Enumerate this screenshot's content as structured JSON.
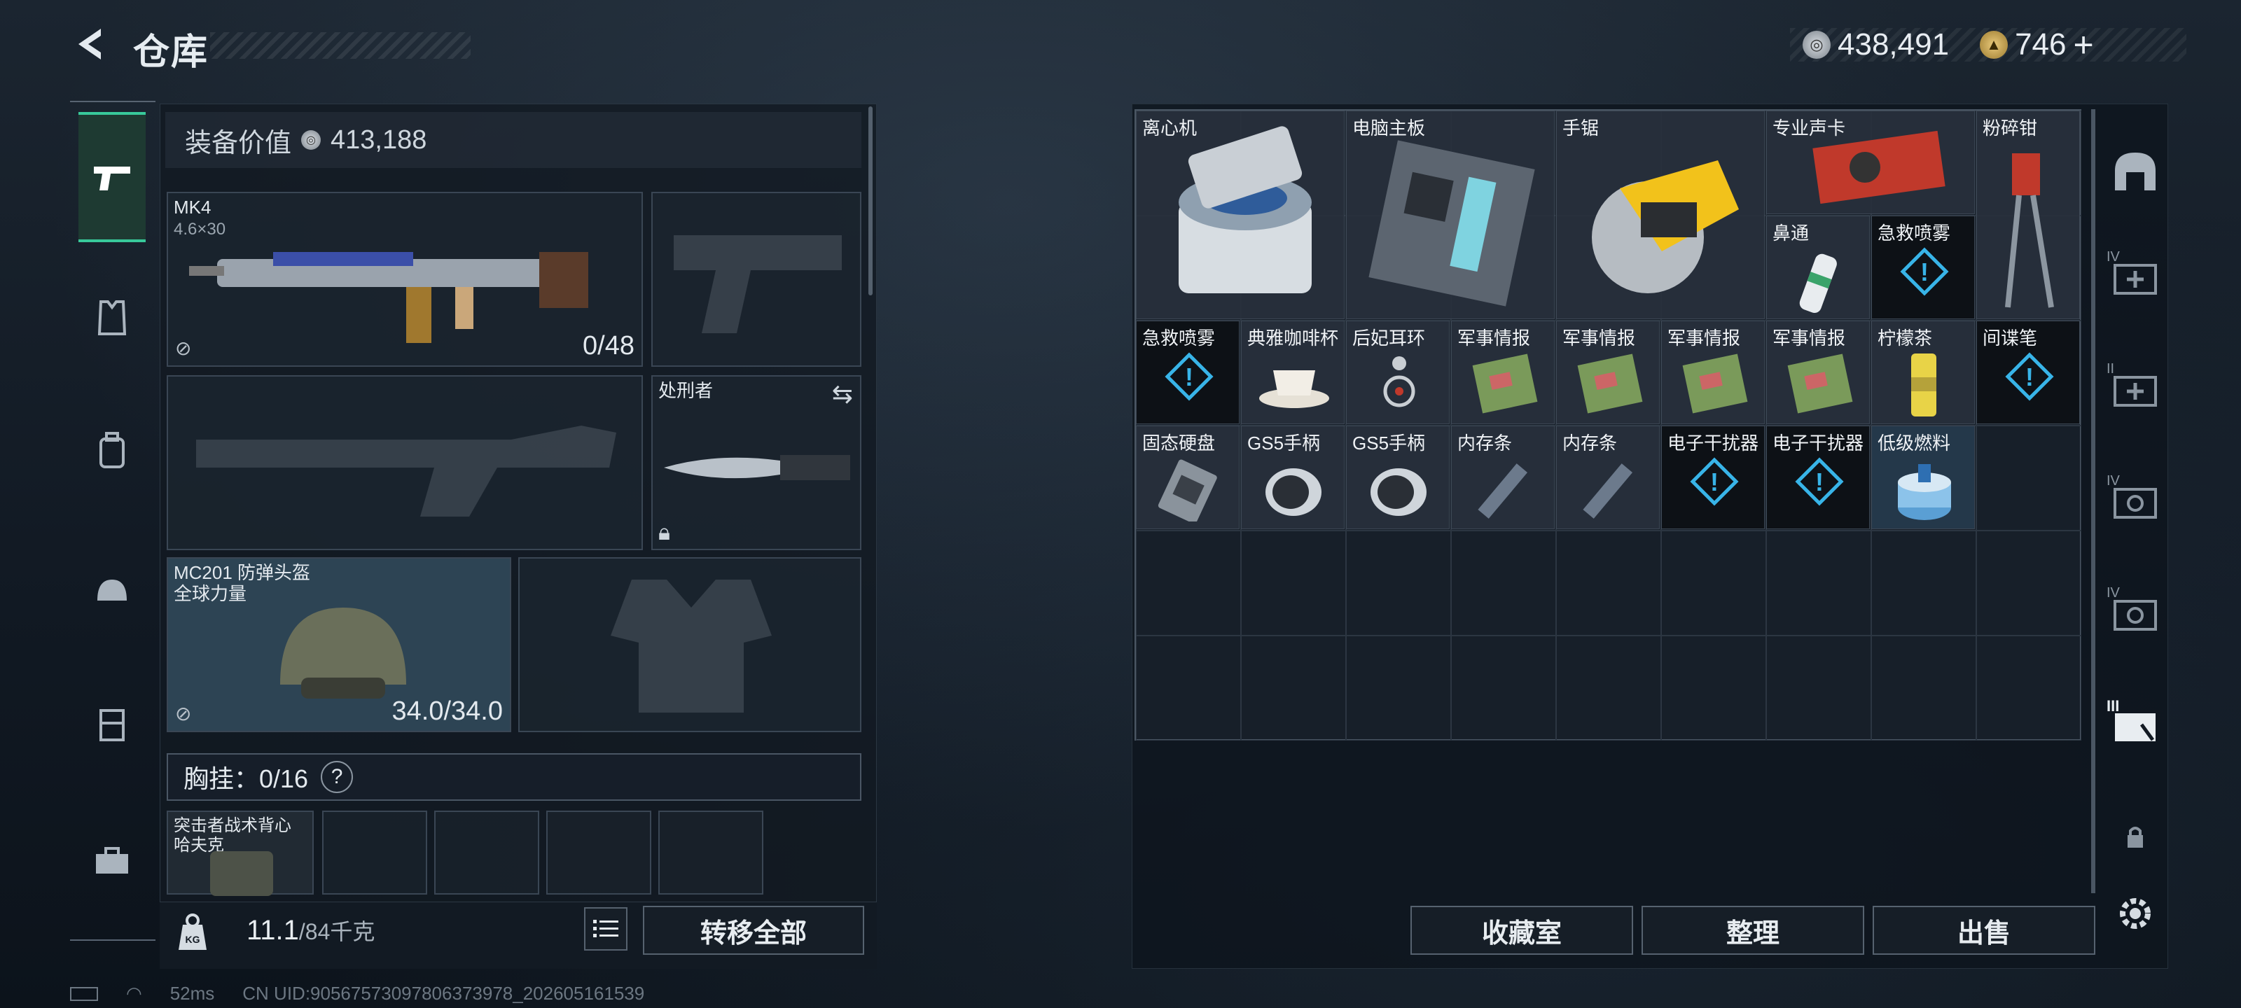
{
  "header": {
    "title": "仓库",
    "silver_amount": "438,491",
    "gold_amount": "746",
    "gold_plus": "+"
  },
  "equipment": {
    "value_label": "装备价值",
    "value": "413,188",
    "primary_weapon": {
      "name": "MK4",
      "ammo_type": "4.6×30",
      "ammo_count": "0/48"
    },
    "melee": {
      "name": "处刑者"
    },
    "helmet": {
      "name": "MC201 防弹头盔",
      "subtitle": "全球力量",
      "durability": "34.0/34.0"
    },
    "chest_rig": {
      "label": "胸挂：",
      "capacity": "0/16",
      "help": "?"
    },
    "vest": {
      "name": "突击者战术背心",
      "subtitle": "哈夫克"
    }
  },
  "bottom_left": {
    "weight_value": "11.1",
    "weight_max": "/84千克",
    "transfer_all": "转移全部",
    "weight_badge": "KG"
  },
  "storage_items": [
    {
      "name": "离心机"
    },
    {
      "name": "电脑主板"
    },
    {
      "name": "手锯"
    },
    {
      "name": "专业声卡"
    },
    {
      "name": "粉碎钳"
    },
    {
      "name": "鼻通"
    },
    {
      "name": "急救喷雾"
    },
    {
      "name": "急救喷雾"
    },
    {
      "name": "典雅咖啡杯"
    },
    {
      "name": "后妃耳环"
    },
    {
      "name": "军事情报"
    },
    {
      "name": "军事情报"
    },
    {
      "name": "军事情报"
    },
    {
      "name": "军事情报"
    },
    {
      "name": "柠檬茶"
    },
    {
      "name": "间谍笔"
    },
    {
      "name": "固态硬盘"
    },
    {
      "name": "GS5手柄"
    },
    {
      "name": "GS5手柄"
    },
    {
      "name": "内存条"
    },
    {
      "name": "内存条"
    },
    {
      "name": "电子干扰器"
    },
    {
      "name": "电子干扰器"
    },
    {
      "name": "低级燃料"
    }
  ],
  "storage_buttons": {
    "collection": "收藏室",
    "sort": "整理",
    "sell": "出售"
  },
  "right_tabs": [
    "IV",
    "II",
    "IV",
    "IV",
    "III"
  ],
  "footer": {
    "ping": "52ms",
    "uid": "CN UID:9056757309780637397​8_202605161539"
  },
  "colors": {
    "accent": "#38c99a",
    "panel": "#121a22"
  }
}
